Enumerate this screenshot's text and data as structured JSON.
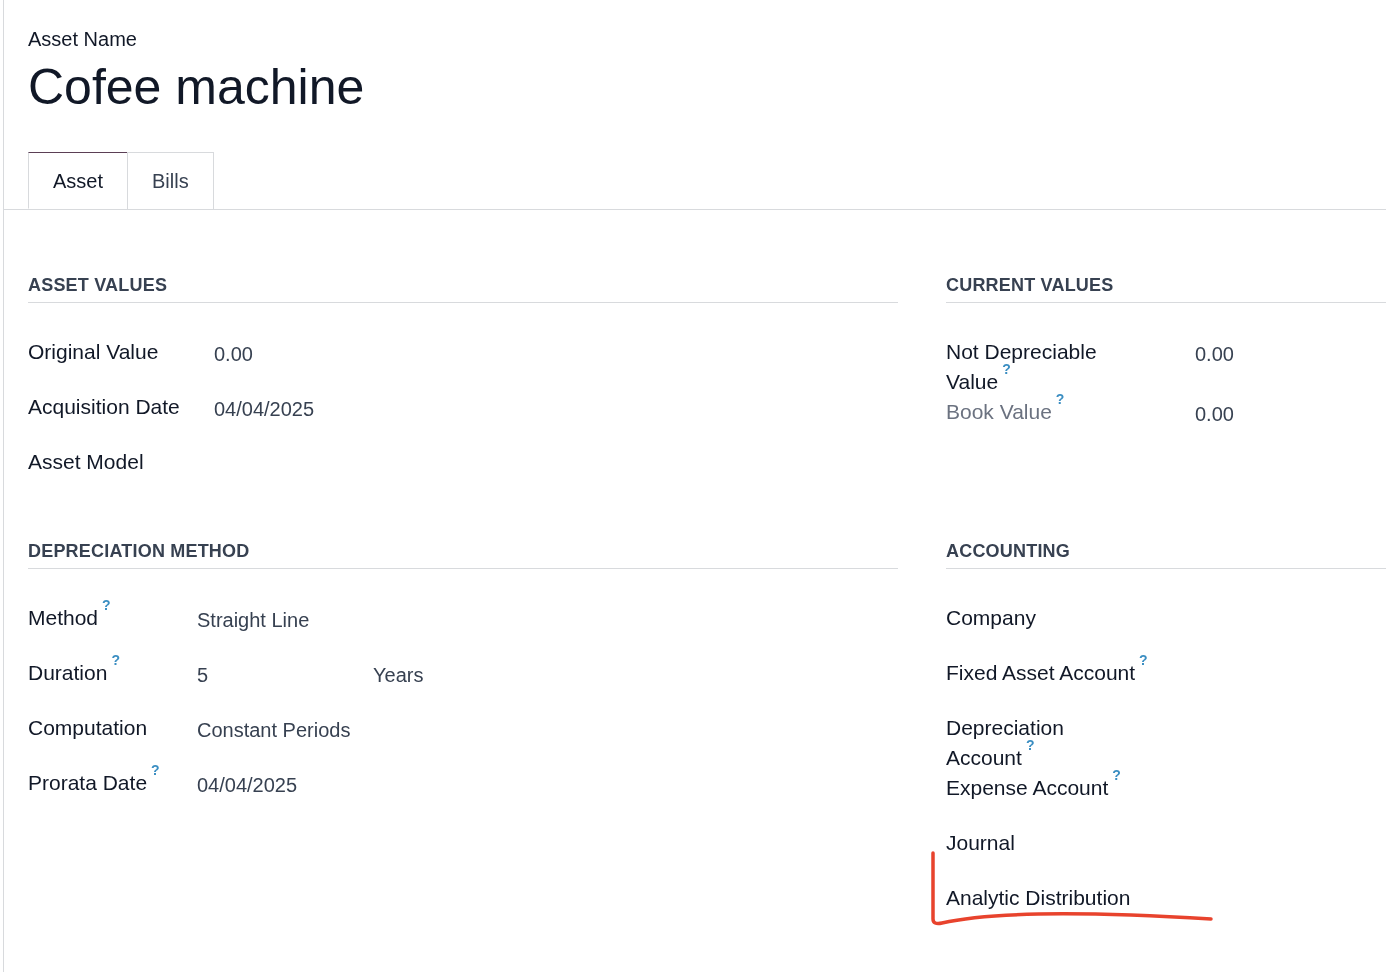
{
  "asset_name_label": "Asset Name",
  "title": "Cofee machine",
  "tabs": [
    {
      "label": "Asset",
      "selected": true
    },
    {
      "label": "Bills",
      "selected": false
    }
  ],
  "left_sections": [
    {
      "title": "ASSET VALUES",
      "fields": [
        {
          "label": "Original Value",
          "value": "0.00",
          "help": false
        },
        {
          "label": "Acquisition Date",
          "value": "04/04/2025",
          "help": false
        },
        {
          "label": "Asset Model",
          "help": false
        }
      ]
    },
    {
      "title": "DEPRECIATION METHOD",
      "fields": [
        {
          "label": "Method",
          "value": "Straight Line",
          "help": true
        },
        {
          "label": "Duration",
          "value": "5",
          "unit": "Years",
          "help": true
        },
        {
          "label": "Computation",
          "value": "Constant Periods",
          "help": false
        },
        {
          "label": "Prorata Date",
          "value": "04/04/2025",
          "help": true
        }
      ]
    }
  ],
  "right_sections": [
    {
      "title": "CURRENT VALUES",
      "fields": [
        {
          "label": "Not Depreciable Value",
          "value": "0.00",
          "help": true,
          "muted": false
        },
        {
          "label": "Book Value",
          "value": "0.00",
          "help": true,
          "muted": true
        }
      ]
    },
    {
      "title": "ACCOUNTING",
      "fields": [
        {
          "label": "Company",
          "help": false
        },
        {
          "label": "Fixed Asset Account",
          "help": true
        },
        {
          "label": "Depreciation Account",
          "help": true
        },
        {
          "label": "Expense Account",
          "help": true
        },
        {
          "label": "Journal",
          "help": false
        },
        {
          "label": "Analytic Distribution",
          "help": false,
          "highlighted": true
        }
      ]
    }
  ],
  "help_mark": "?"
}
